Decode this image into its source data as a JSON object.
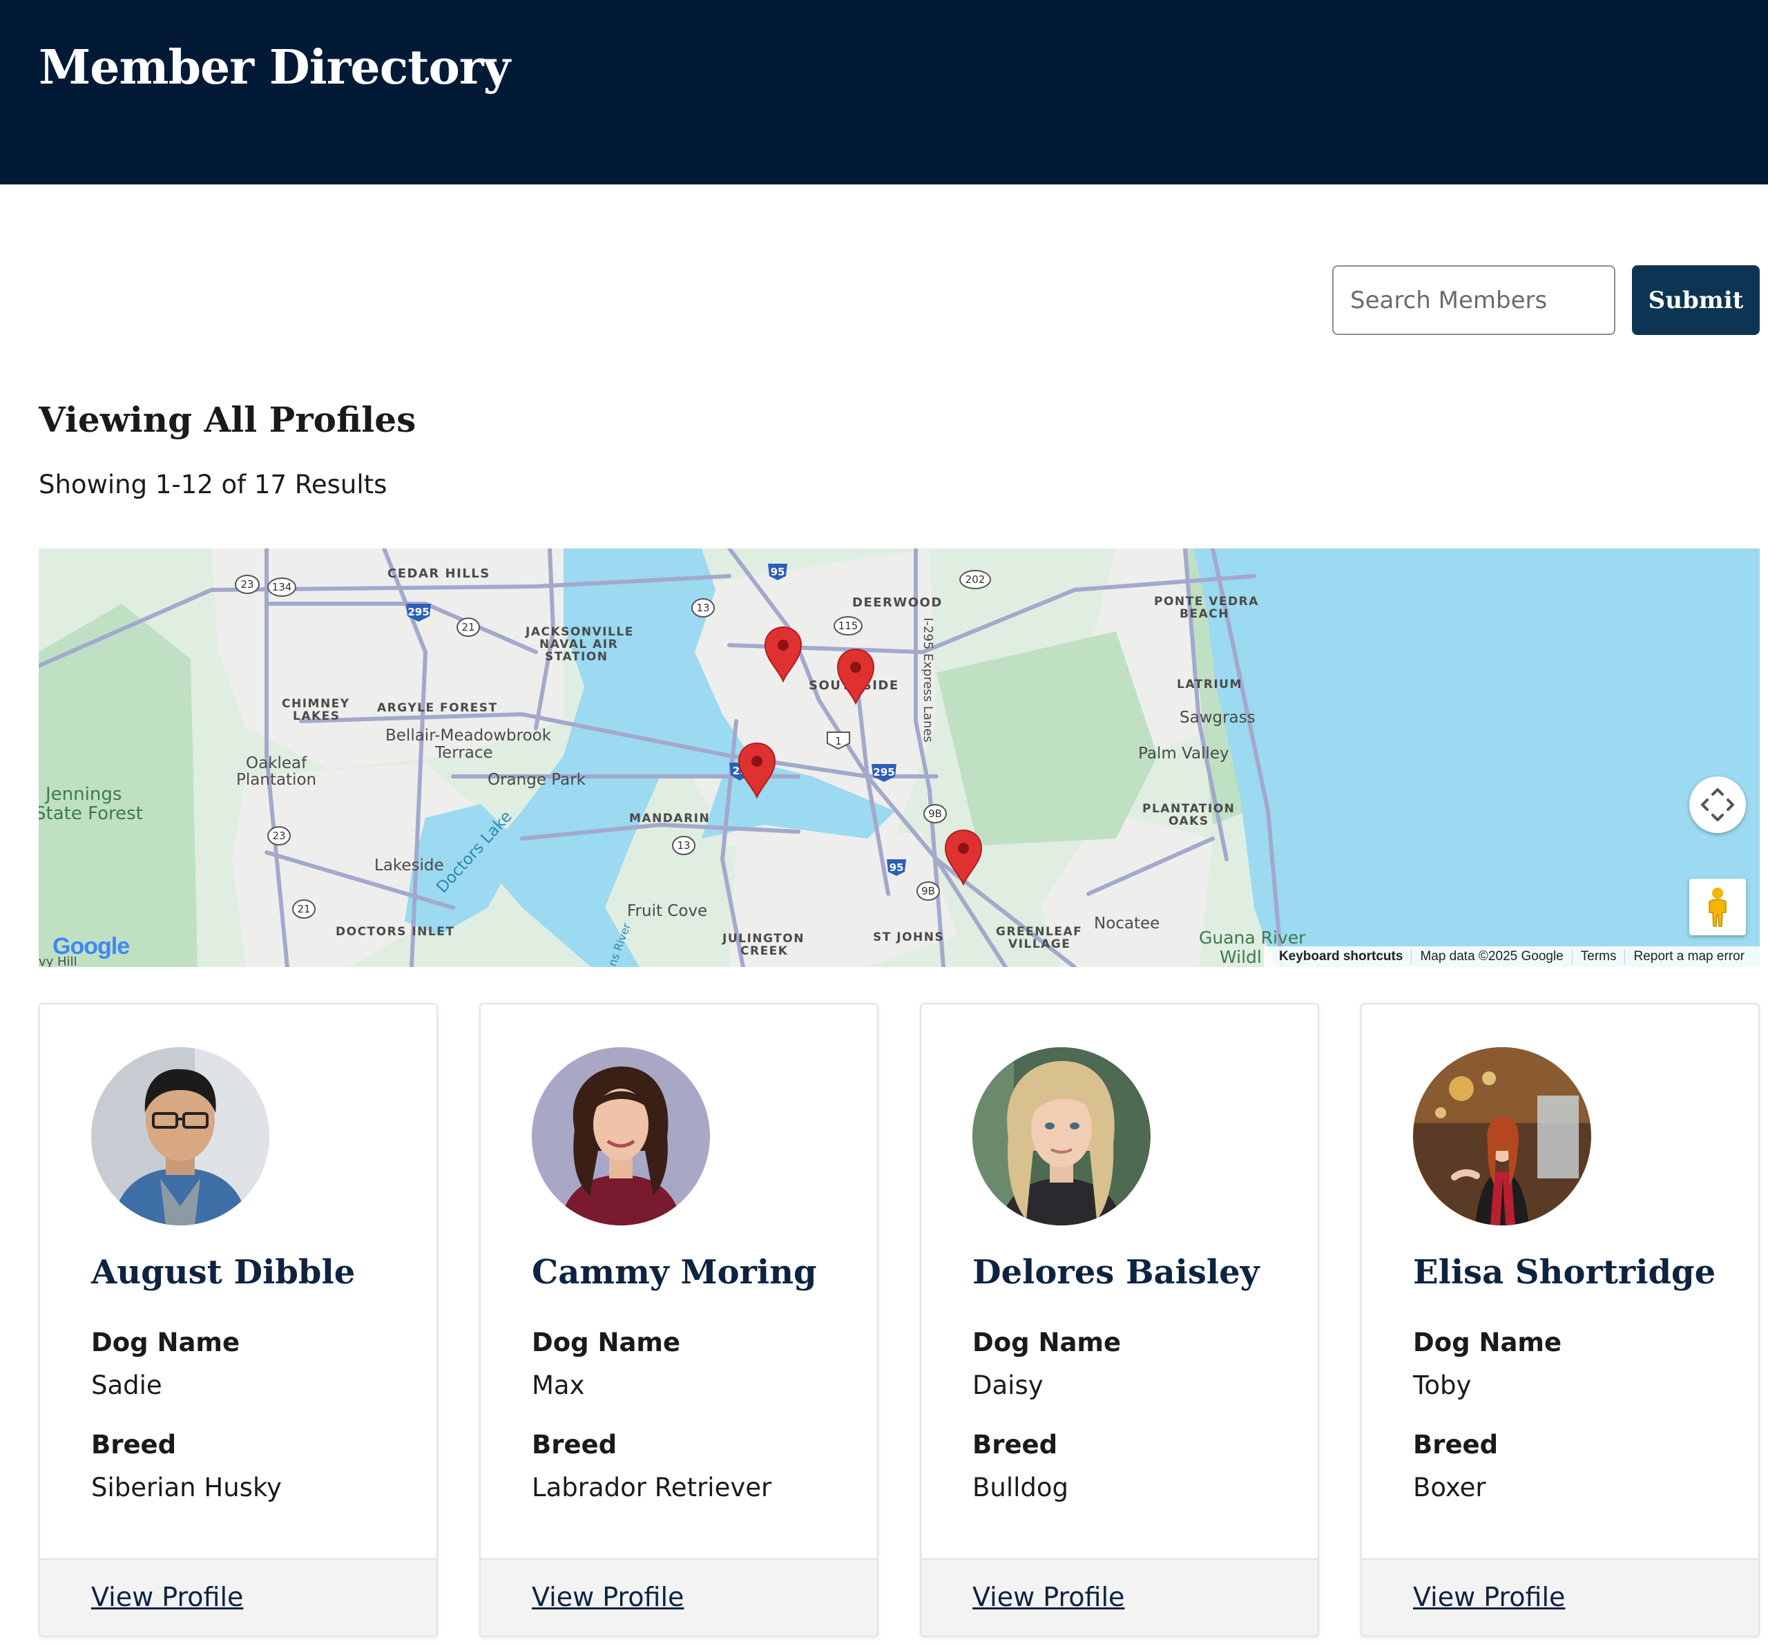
{
  "header": {
    "title": "Member Directory"
  },
  "search": {
    "placeholder": "Search Members",
    "submit_label": "Submit"
  },
  "listing": {
    "title": "Viewing All Profiles",
    "results_text": "Showing 1-12 of 17 Results"
  },
  "map": {
    "places": {
      "cedar_hills": "CEDAR HILLS",
      "jax_nas_1": "JACKSONVILLE",
      "jax_nas_2": "NAVAL AIR",
      "jax_nas_3": "STATION",
      "deerwood": "DEERWOOD",
      "ponte_vedra_1": "PONTE VEDRA",
      "ponte_vedra_2": "BEACH",
      "latrium": "LATRIUM",
      "sawgrass": "Sawgrass",
      "palm_valley": "Palm Valley",
      "plantation_oaks_1": "PLANTATION",
      "plantation_oaks_2": "OAKS",
      "southside": "SOUTHSIDE",
      "chimney_lakes_1": "CHIMNEY",
      "chimney_lakes_2": "LAKES",
      "argyle_forest": "ARGYLE FOREST",
      "bellair_1": "Bellair-Meadowbrook",
      "bellair_2": "Terrace",
      "orange_park": "Orange Park",
      "oakleaf_1": "Oakleaf",
      "oakleaf_2": "Plantation",
      "jennings_1": "Jennings",
      "jennings_2": "State Forest",
      "mandarin": "MANDARIN",
      "lakeside": "Lakeside",
      "doctors_lake": "Doctors Lake",
      "fruit_cove": "Fruit Cove",
      "doctors_inlet": "DOCTORS INLET",
      "julington_1": "JULINGTON",
      "julington_2": "CREEK",
      "st_johns": "ST JOHNS",
      "greenleaf_1": "GREENLEAF",
      "greenleaf_2": "VILLAGE",
      "nocatee": "Nocatee",
      "guana": "Guana River",
      "wildl": "Wildl",
      "express_lanes": "I-295 Express Lanes",
      "johns_river": "ns River",
      "ivy_hill": "vy Hill"
    },
    "shields": {
      "r23a": "23",
      "r134": "134",
      "r295a": "295",
      "r21a": "21",
      "r95a": "95",
      "r13a": "13",
      "r115": "115",
      "r202": "202",
      "r1": "1",
      "r295b": "295",
      "r29": "29",
      "r9b_a": "9B",
      "r13b": "13",
      "r95b": "95",
      "r9b_b": "9B",
      "r23b": "23",
      "r21b": "21"
    },
    "google_logo": "Google",
    "footer": {
      "shortcuts": "Keyboard shortcuts",
      "data": "Map data ©2025 Google",
      "terms": "Terms",
      "report": "Report a map error"
    },
    "colors": {
      "water": "#9bdaf0",
      "land": "#d5ecd8",
      "road": "#a3a9cc",
      "pin": "#e03131"
    }
  },
  "members": [
    {
      "name": "August Dibble",
      "dog_label": "Dog Name",
      "dog": "Sadie",
      "breed_label": "Breed",
      "breed": "Siberian Husky",
      "link": "View Profile"
    },
    {
      "name": "Cammy Moring",
      "dog_label": "Dog Name",
      "dog": "Max",
      "breed_label": "Breed",
      "breed": "Labrador Retriever",
      "link": "View Profile"
    },
    {
      "name": "Delores Baisley",
      "dog_label": "Dog Name",
      "dog": "Daisy",
      "breed_label": "Breed",
      "breed": "Bulldog",
      "link": "View Profile"
    },
    {
      "name": "Elisa Shortridge",
      "dog_label": "Dog Name",
      "dog": "Toby",
      "breed_label": "Breed",
      "breed": "Boxer",
      "link": "View Profile"
    }
  ],
  "colors": {
    "header_bg": "#021a36",
    "button_bg": "#0d3553",
    "name_color": "#0d2340"
  }
}
